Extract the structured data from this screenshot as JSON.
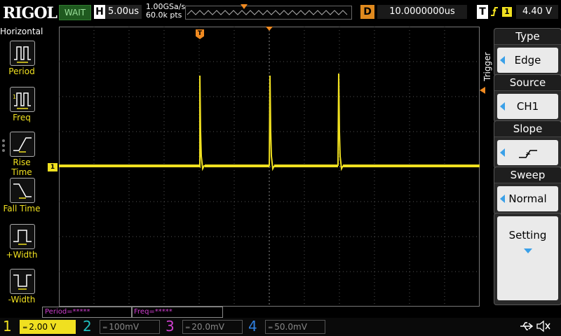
{
  "header": {
    "brand": "RIGOL",
    "run_state": "WAIT",
    "h_label": "H",
    "timebase": "5.00us",
    "sample_rate": "1.00GSa/s",
    "mem_depth": "60.0k pts",
    "delay_label": "D",
    "delay": "10.0000000us",
    "trig_label": "T",
    "trig_edge_icon": "rising-edge-icon",
    "trig_source_num": "1",
    "trig_level": "4.40 V"
  },
  "left_menu": {
    "title": "Horizontal",
    "items": [
      {
        "label": "Period",
        "icon": "period-icon"
      },
      {
        "label": "Freq",
        "icon": "freq-icon"
      },
      {
        "label": "Rise Time",
        "icon": "rise-time-icon"
      },
      {
        "label": "Fall Time",
        "icon": "fall-time-icon"
      },
      {
        "label": "+Width",
        "icon": "pos-width-icon"
      },
      {
        "label": "-Width",
        "icon": "neg-width-icon"
      }
    ]
  },
  "right_menu": {
    "vertical_label": "Trigger",
    "items": [
      {
        "title": "Type",
        "value": "Edge"
      },
      {
        "title": "Source",
        "value": "CH1"
      },
      {
        "title": "Slope",
        "value": ""
      },
      {
        "title": "Sweep",
        "value": "Normal"
      }
    ],
    "setting": "Setting"
  },
  "measurements": {
    "period": "Period=*****",
    "freq": "Freq=*****"
  },
  "channels": [
    {
      "num": "1",
      "scale": "2.00 V",
      "color": "#f0e020"
    },
    {
      "num": "2",
      "scale": "100mV",
      "color": "#20c0c0"
    },
    {
      "num": "3",
      "scale": "20.0mV",
      "color": "#d040d0"
    },
    {
      "num": "4",
      "scale": "50.0mV",
      "color": "#3080e0"
    }
  ],
  "grid_marker": {
    "ch1": "1",
    "trig": "T"
  },
  "colors": {
    "ch1": "#f0e020",
    "accent": "#f08a20",
    "select_arrow": "#3aa0e8"
  }
}
